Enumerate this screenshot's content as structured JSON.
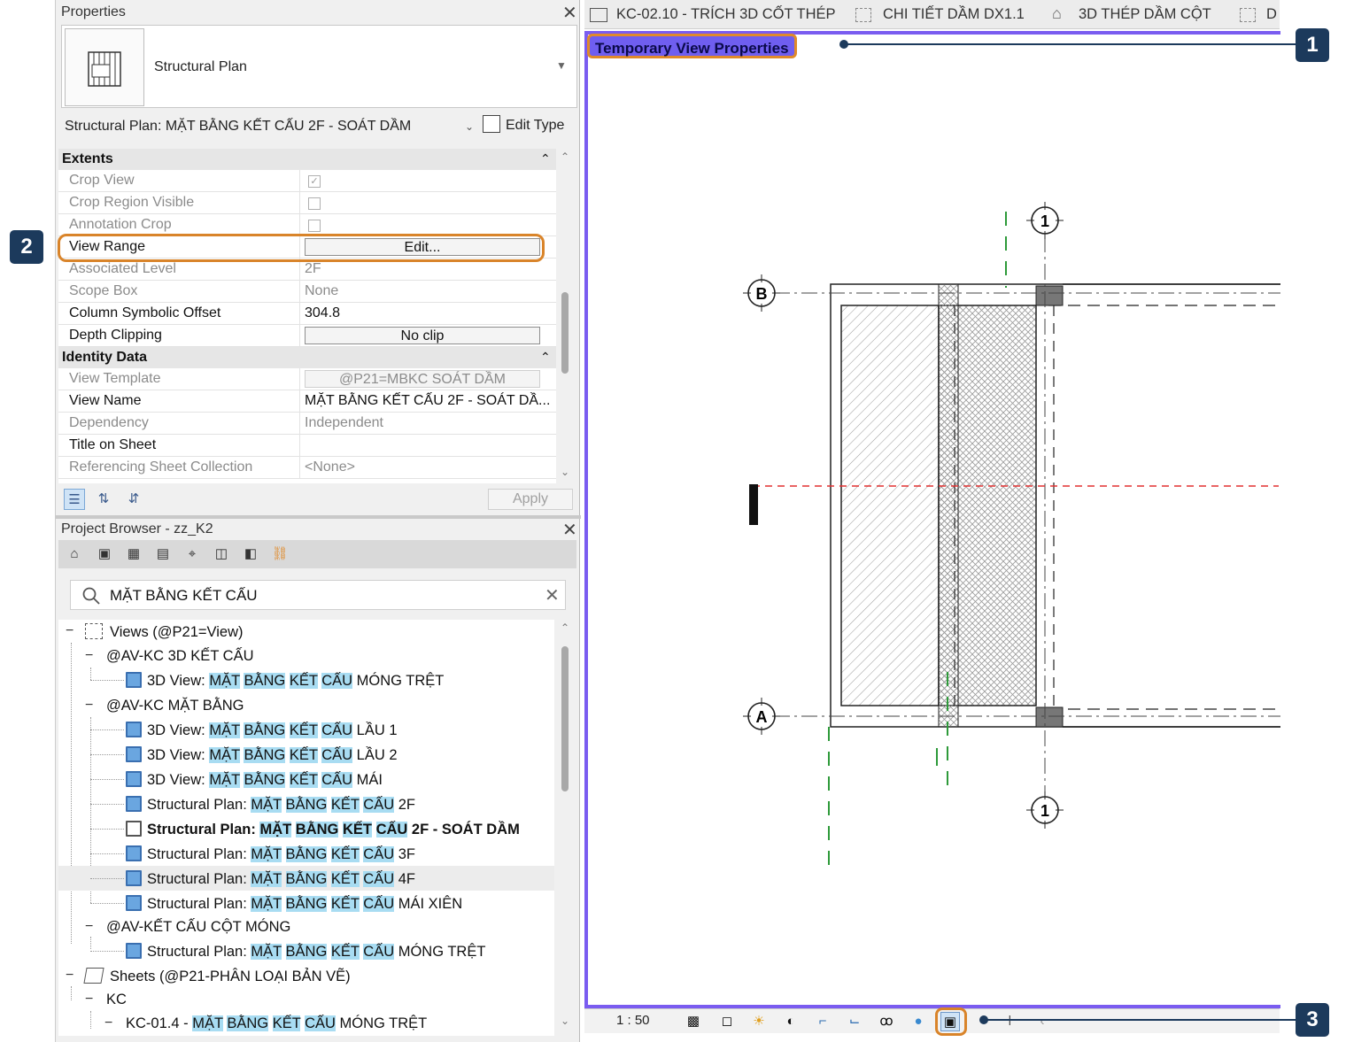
{
  "properties": {
    "title": "Properties",
    "type_name": "Structural Plan",
    "selector": "Structural Plan: MẶT BẰNG KẾT CẤU 2F - SOÁT DẦM",
    "edit_type": "Edit Type",
    "groups": {
      "extents": "Extents",
      "identity": "Identity Data"
    },
    "rows": {
      "crop_view": "Crop View",
      "crop_region": "Crop Region Visible",
      "annotation_crop": "Annotation Crop",
      "view_range": "View Range",
      "view_range_value": "Edit...",
      "associated_level": "Associated Level",
      "associated_level_value": "2F",
      "scope_box": "Scope Box",
      "scope_box_value": "None",
      "column_offset": "Column Symbolic Offset",
      "column_offset_value": "304.8",
      "depth_clipping": "Depth Clipping",
      "depth_clipping_value": "No clip",
      "view_template": "View Template",
      "view_template_value": "@P21=MBKC SOÁT DẦM",
      "view_name": "View Name",
      "view_name_value": "MẶT BẰNG KẾT CẤU 2F - SOÁT DẦ...",
      "dependency": "Dependency",
      "dependency_value": "Independent",
      "title_on_sheet": "Title on Sheet",
      "referencing_sheet": "Referencing Sheet Collection",
      "referencing_sheet_value": "<None>"
    },
    "apply": "Apply"
  },
  "browser": {
    "title": "Project Browser - zz_K2",
    "search_value": "MẶT BẰNG KẾT CẤU",
    "views_root": "Views (@P21=View)",
    "group_3d": "@AV-KC 3D KẾT CẤU",
    "group_mb": "@AV-KC MẶT BẰNG",
    "group_cot": "@AV-KẾT CẤU CỘT MÓNG",
    "sheets_root": "Sheets (@P21-PHÂN LOẠI BẢN VẼ)",
    "sheets_kc": "KC",
    "hl_a": "MẶT",
    "hl_b": "BẰNG",
    "hl_c": "KẾT",
    "hl_d": "CẤU",
    "prefix_3d": "3D View:",
    "prefix_sp": "Structural Plan:",
    "suffix_mong_tret": "MÓNG TRỆT",
    "suffix_lau1": "LẦU 1",
    "suffix_lau2": "LẦU 2",
    "suffix_mai": "MÁI",
    "suffix_2f": "2F",
    "suffix_2f_soat": "2F - SOÁT DẦM",
    "suffix_3f": "3F",
    "suffix_4f": "4F",
    "suffix_mai_xien": "MÁI XIÊN",
    "sheet_prefix": "KC-01.4 -",
    "sheet_suffix": "MÓNG TRỆT"
  },
  "tabs": [
    "KC-02.10 - TRÍCH 3D CỐT THÉP",
    "CHI TIẾT DẦM DX1.1",
    "3D THÉP DẦM CỘT",
    "D"
  ],
  "view": {
    "temp_label": "Temporary View Properties",
    "grid_b": "B",
    "grid_a": "A",
    "grid_1_top": "1",
    "grid_1_bottom": "1",
    "scale": "1 : 50"
  },
  "callouts": [
    "1",
    "2",
    "3"
  ],
  "colors": {
    "accent_frame": "#7a5cf0",
    "highlight_orange": "#d9842a",
    "callout_bg": "#1c3a5c",
    "search_highlight": "#a8dcf2"
  }
}
